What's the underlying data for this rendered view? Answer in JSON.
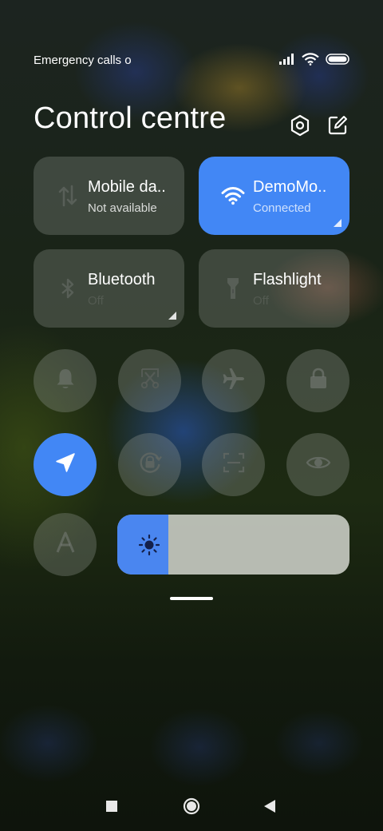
{
  "status_bar": {
    "carrier_text": "Emergency calls o",
    "icons": [
      "signal-icon",
      "wifi-icon",
      "battery-icon"
    ]
  },
  "header": {
    "title": "Control centre",
    "icons": [
      "settings-icon",
      "edit-icon"
    ]
  },
  "tiles": [
    {
      "label": "Mobile da..",
      "sub": "Not available",
      "icon": "mobile-data-icon",
      "active": false
    },
    {
      "label": "DemoMo..",
      "sub": "Connected",
      "icon": "wifi-icon",
      "active": true
    },
    {
      "label": "Bluetooth",
      "sub": "Off",
      "icon": "bluetooth-icon",
      "active": false
    },
    {
      "label": "Flashlight",
      "sub": "Off",
      "icon": "flashlight-icon",
      "active": false
    }
  ],
  "toggles": [
    {
      "icon": "bell-icon",
      "active": false
    },
    {
      "icon": "screenshot-scissors-icon",
      "active": false
    },
    {
      "icon": "airplane-icon",
      "active": false
    },
    {
      "icon": "lock-icon",
      "active": false
    },
    {
      "icon": "location-icon",
      "active": true
    },
    {
      "icon": "rotation-lock-icon",
      "active": false
    },
    {
      "icon": "scanner-icon",
      "active": false
    },
    {
      "icon": "eye-icon",
      "active": false
    },
    {
      "icon": "auto-brightness-icon",
      "active": false
    }
  ],
  "brightness": {
    "icon": "sun-icon",
    "level": 0.22
  },
  "colors": {
    "accent": "#4287f5",
    "tile_bg": "rgba(150,155,150,0.30)",
    "slider_track": "#cdd0c8"
  },
  "navbar": {
    "icons": [
      "recents-square-icon",
      "home-circle-icon",
      "back-triangle-icon"
    ]
  }
}
